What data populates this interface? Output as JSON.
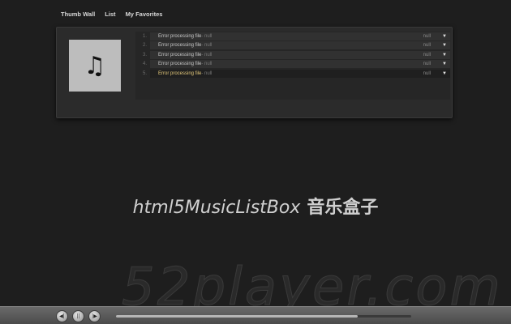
{
  "nav": {
    "items": [
      "Thumb Wall",
      "List",
      "My Favorites"
    ]
  },
  "cover": {
    "icon": "music-note-icon",
    "glyph": "♫"
  },
  "tracks": [
    {
      "num": "1.",
      "title": "Error processing file",
      "artist": " - null",
      "duration": "null",
      "active": false
    },
    {
      "num": "2.",
      "title": "Error processing file",
      "artist": " - null",
      "duration": "null",
      "active": false
    },
    {
      "num": "3.",
      "title": "Error processing file",
      "artist": " - null",
      "duration": "null",
      "active": false
    },
    {
      "num": "4.",
      "title": "Error processing file",
      "artist": " - null",
      "duration": "null",
      "active": false
    },
    {
      "num": "5.",
      "title": "Error processing file",
      "artist": " - null",
      "duration": "null",
      "active": true
    }
  ],
  "track_menu_glyph": "▼",
  "hero": {
    "en": "html5MusicListBox",
    "cn": "音乐盒子"
  },
  "watermark": "52player.com",
  "player": {
    "prev_glyph": "◀|",
    "play_glyph": "||",
    "next_glyph": "|▶",
    "progress": 0.82
  }
}
